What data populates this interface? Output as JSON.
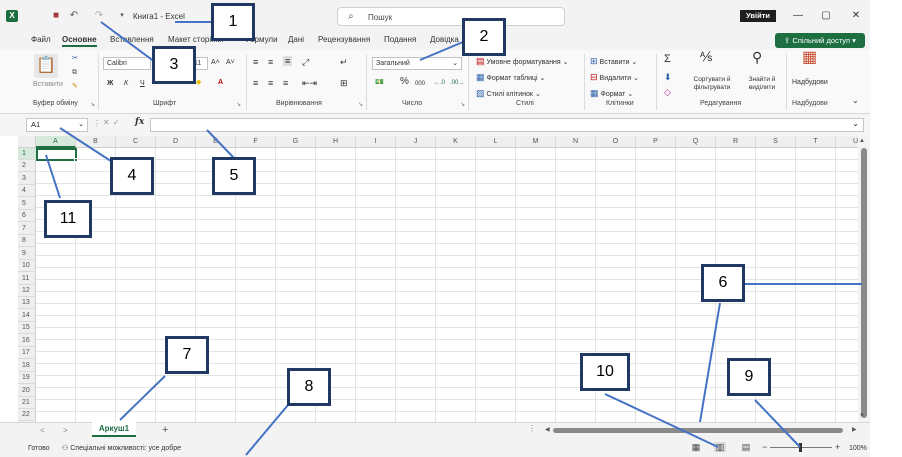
{
  "titlebar": {
    "title": "Книга1  -  Excel",
    "search_placeholder": "Пошук",
    "signin_label": "Увійти",
    "icons": [
      "excel-logo-icon",
      "save-icon",
      "undo-icon",
      "redo-icon",
      "customize-qat-icon"
    ],
    "window_buttons": [
      "—",
      "▢",
      "✕"
    ]
  },
  "tabs": [
    "Файл",
    "Основне",
    "Вставлення",
    "Макет сторінки",
    "Формули",
    "Дані",
    "Рецензування",
    "Подання",
    "Довідка"
  ],
  "active_tab": "Основне",
  "share_label": "Спільний доступ",
  "ribbon": {
    "clipboard": {
      "label": "Буфер обміну",
      "paste": "Вставити"
    },
    "font": {
      "label": "Шрифт",
      "font_name": "Calibri",
      "font_size": "11",
      "bold": "Ж",
      "italic": "К",
      "underline": "Ч"
    },
    "alignment": {
      "label": "Вирівнювання"
    },
    "number": {
      "label": "Число",
      "format": "Загальний"
    },
    "styles": {
      "label": "Стилі",
      "cond": "Умовне форматування",
      "table": "Формат таблиці",
      "cell": "Стилі клітинок"
    },
    "cells": {
      "label": "Клітинки",
      "insert": "Вставити",
      "delete": "Видалити",
      "format": "Формат"
    },
    "editing": {
      "label": "Редагування",
      "sort": "Сортувати й фільтрувати",
      "find": "Знайти й виділити"
    },
    "addins": {
      "label": "Надбудови",
      "btn": "Надбудови"
    }
  },
  "formula_bar": {
    "name_box": "A1",
    "formula": ""
  },
  "columns": [
    "A",
    "B",
    "C",
    "D",
    "E",
    "F",
    "G",
    "H",
    "I",
    "J",
    "K",
    "L",
    "M",
    "N",
    "O",
    "P",
    "Q",
    "R",
    "S",
    "T",
    "U"
  ],
  "rows": [
    "1",
    "2",
    "3",
    "4",
    "5",
    "6",
    "7",
    "8",
    "9",
    "10",
    "11",
    "12",
    "13",
    "14",
    "15",
    "16",
    "17",
    "18",
    "19",
    "20",
    "21",
    "22"
  ],
  "selected_cell": "A1",
  "sheet": {
    "tab": "Аркуш1",
    "add": "+",
    "prev": "<",
    "next": ">",
    "dots": "⋮"
  },
  "status": {
    "ready": "Готово",
    "accessibility": "Спеціальні можливості: усе добре",
    "zoom": "100%"
  },
  "callouts": [
    "1",
    "2",
    "3",
    "4",
    "5",
    "6",
    "7",
    "8",
    "9",
    "10",
    "11"
  ],
  "colors": {
    "excel_green": "#1d6f42",
    "callout_border": "#1f3864",
    "arrow": "#4472c4"
  }
}
